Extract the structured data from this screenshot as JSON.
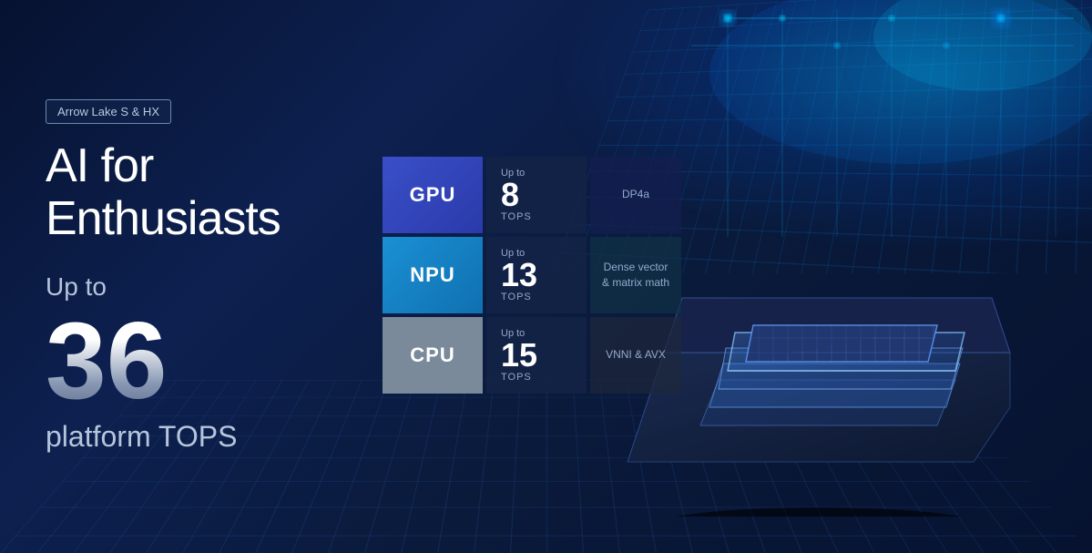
{
  "badge": {
    "label": "Arrow Lake S & HX"
  },
  "hero": {
    "title": "AI for Enthusiasts",
    "up_to": "Up to",
    "number": "36",
    "platform_tops": "platform TOPS"
  },
  "stats": [
    {
      "id": "gpu",
      "label": "GPU",
      "up_to": "Up to",
      "value": "8",
      "unit": "TOPS",
      "description": "DP4a",
      "bg_class": "gpu-bg",
      "desc_class": "gpu-desc"
    },
    {
      "id": "npu",
      "label": "NPU",
      "up_to": "Up to",
      "value": "13",
      "unit": "TOPS",
      "description": "Dense vector & matrix math",
      "bg_class": "npu-bg",
      "desc_class": "npu-desc"
    },
    {
      "id": "cpu",
      "label": "CPU",
      "up_to": "Up to",
      "value": "15",
      "unit": "TOPS",
      "description": "VNNI & AVX",
      "bg_class": "cpu-bg",
      "desc_class": "cpu-desc"
    }
  ],
  "colors": {
    "background": "#0a1a3a",
    "gpu_blue": "#3a4fc8",
    "npu_cyan": "#1a90d4",
    "cpu_gray": "#7a8a9a",
    "text_primary": "#ffffff",
    "text_secondary": "rgba(180,200,230,0.9)"
  }
}
